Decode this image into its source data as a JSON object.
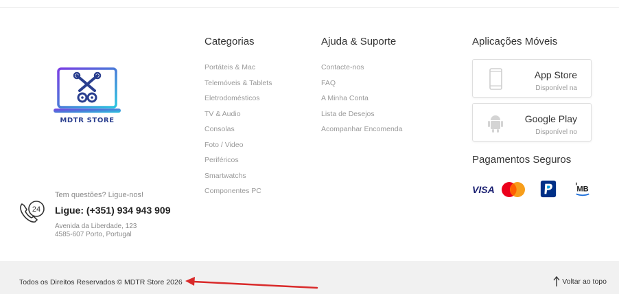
{
  "brand": {
    "name": "MDTR STORE"
  },
  "contact": {
    "question": "Tem questões? Ligue-nos!",
    "phone": "Ligue: (+351) 934 943 909",
    "address_line1": "Avenida da Liberdade, 123",
    "address_line2": "4585-607 Porto, Portugal",
    "icon_badge": "24"
  },
  "categories": {
    "title": "Categorias",
    "items": [
      "Portáteis & Mac",
      "Telemóveis & Tablets",
      "Eletrodomésticos",
      "TV & Audio",
      "Consolas",
      "Foto / Video",
      "Periféricos",
      "Smartwatchs",
      "Componentes PC"
    ]
  },
  "support": {
    "title": "Ajuda & Suporte",
    "items": [
      "Contacte-nos",
      "FAQ",
      "A Minha Conta",
      "Lista de Desejos",
      "Acompanhar Encomenda"
    ]
  },
  "apps": {
    "title": "Aplicações Móveis",
    "app_store": {
      "name": "App Store",
      "sub": "Disponível na"
    },
    "google_play": {
      "name": "Google Play",
      "sub": "Disponível no"
    }
  },
  "payments": {
    "title": "Pagamentos Seguros",
    "visa": "VISA",
    "multibanco": "MB"
  },
  "footer": {
    "copyright": "Todos os Direitos Reservados © MDTR Store 2026",
    "back_to_top": "Voltar ao topo"
  },
  "colors": {
    "bottom_bar": "#f1f1f1",
    "annotation_arrow": "#d92a2a",
    "visa_blue": "#1a1f71",
    "paypal_blue": "#003087"
  },
  "icons": [
    "laptop-tools-logo",
    "phone-24-icon",
    "smartphone-icon",
    "android-icon",
    "mastercard-logo",
    "paypal-logo",
    "multibanco-logo",
    "arrow-up-icon"
  ]
}
